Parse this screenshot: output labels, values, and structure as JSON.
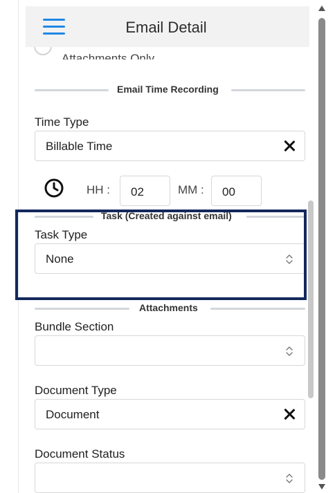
{
  "header": {
    "title": "Email Detail"
  },
  "radio_partial": {
    "label": "Attachments Only"
  },
  "sections": {
    "email_time_recording": "Email Time Recording",
    "task": "Task (Created against email)",
    "attachments": "Attachments"
  },
  "time_type": {
    "label": "Time Type",
    "value": "Billable Time"
  },
  "time": {
    "hh_label": "HH :",
    "hh_value": "02",
    "mm_label": "MM :",
    "mm_value": "00"
  },
  "task_type": {
    "label": "Task Type",
    "value": "None"
  },
  "bundle_section": {
    "label": "Bundle Section",
    "value": ""
  },
  "document_type": {
    "label": "Document Type",
    "value": "Document"
  },
  "document_status": {
    "label": "Document Status",
    "value": ""
  },
  "colors": {
    "accent": "#1e88e5",
    "highlight": "#13285c",
    "header_bg": "#f2f2f2"
  }
}
